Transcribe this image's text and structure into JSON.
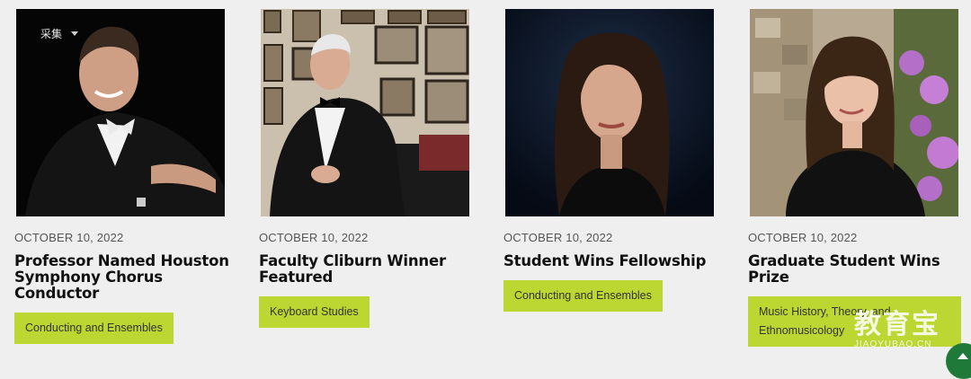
{
  "overlay": {
    "collect_label": "采集"
  },
  "cards": [
    {
      "date": "OCTOBER 10, 2022",
      "title": "Professor Named Houston Symphony Chorus Conductor",
      "tags": [
        "Conducting and Ensembles"
      ]
    },
    {
      "date": "OCTOBER 10, 2022",
      "title": "Faculty Cliburn Winner Featured",
      "tags": [
        "Keyboard Studies"
      ]
    },
    {
      "date": "OCTOBER 10, 2022",
      "title": "Student Wins Fellowship",
      "tags": [
        "Conducting and Ensembles"
      ]
    },
    {
      "date": "OCTOBER 10, 2022",
      "title": "Graduate Student Wins Prize",
      "tags": [
        "Music History, Theory, and Ethnomusicology"
      ]
    }
  ],
  "watermark": {
    "chinese": "教育宝",
    "latin": "JIAOYUBAO.CN"
  },
  "colors": {
    "accent": "#bcd632",
    "background": "#efefef",
    "scroll_button": "#1f7a3a"
  }
}
